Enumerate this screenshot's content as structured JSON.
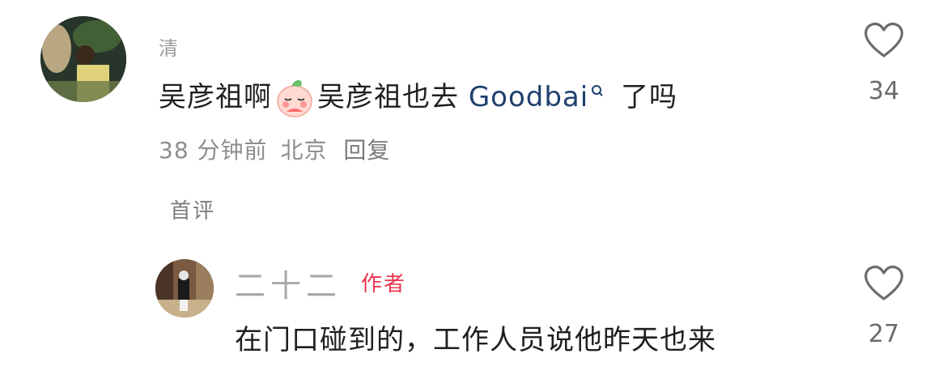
{
  "comment1": {
    "username": "清",
    "text_part1": "吴彦祖啊",
    "emoji": "shy-face-emoji",
    "text_part2": "吴彦祖也去",
    "link_text": "Goodbai",
    "text_part3": "了吗",
    "time": "38 分钟前",
    "location": "北京",
    "reply_label": "回复",
    "like_count": "34"
  },
  "first_comment_label": "首评",
  "comment2": {
    "username": "二十二",
    "author_tag": "作者",
    "text": "在门口碰到的，工作人员说他昨天也来",
    "like_count": "27"
  },
  "colors": {
    "author_tag": "#e8374f",
    "link": "#1f3f6e",
    "meta": "#8e8e8e"
  }
}
